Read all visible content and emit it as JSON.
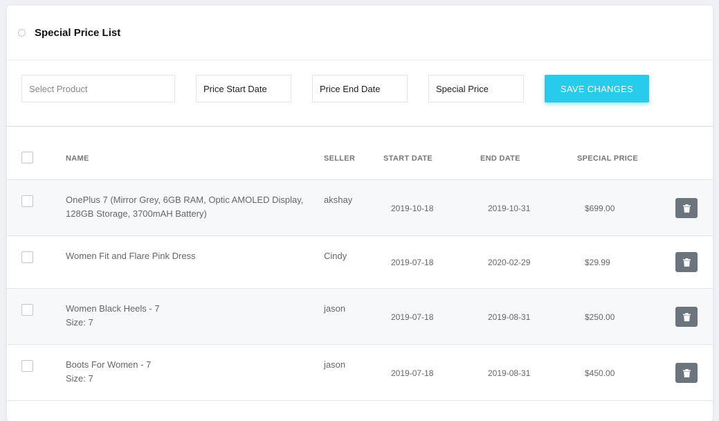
{
  "header": {
    "title": "Special Price List"
  },
  "filters": {
    "product_placeholder": "Select Product",
    "start_date": "Price Start Date",
    "end_date": "Price End Date",
    "special_price": "Special Price",
    "save_label": "SAVE CHANGES"
  },
  "columns": {
    "name": "NAME",
    "seller": "SELLER",
    "start_date": "START DATE",
    "end_date": "END DATE",
    "special_price": "SPECIAL PRICE"
  },
  "rows": [
    {
      "name": "OnePlus 7 (Mirror Grey, 6GB RAM, Optic AMOLED Display, 128GB Storage, 3700mAH Battery)",
      "size": "",
      "seller": "akshay",
      "start": "2019-10-18",
      "end": "2019-10-31",
      "price": "$699.00"
    },
    {
      "name": "Women Fit and Flare Pink Dress",
      "size": "",
      "seller": "Cindy",
      "start": "2019-07-18",
      "end": "2020-02-29",
      "price": "$29.99"
    },
    {
      "name": "Women Black Heels - 7",
      "size": "Size: 7",
      "seller": "jason",
      "start": "2019-07-18",
      "end": "2019-08-31",
      "price": "$250.00"
    },
    {
      "name": "Boots For Women - 7",
      "size": "Size: 7",
      "seller": "jason",
      "start": "2019-07-18",
      "end": "2019-08-31",
      "price": "$450.00"
    }
  ]
}
